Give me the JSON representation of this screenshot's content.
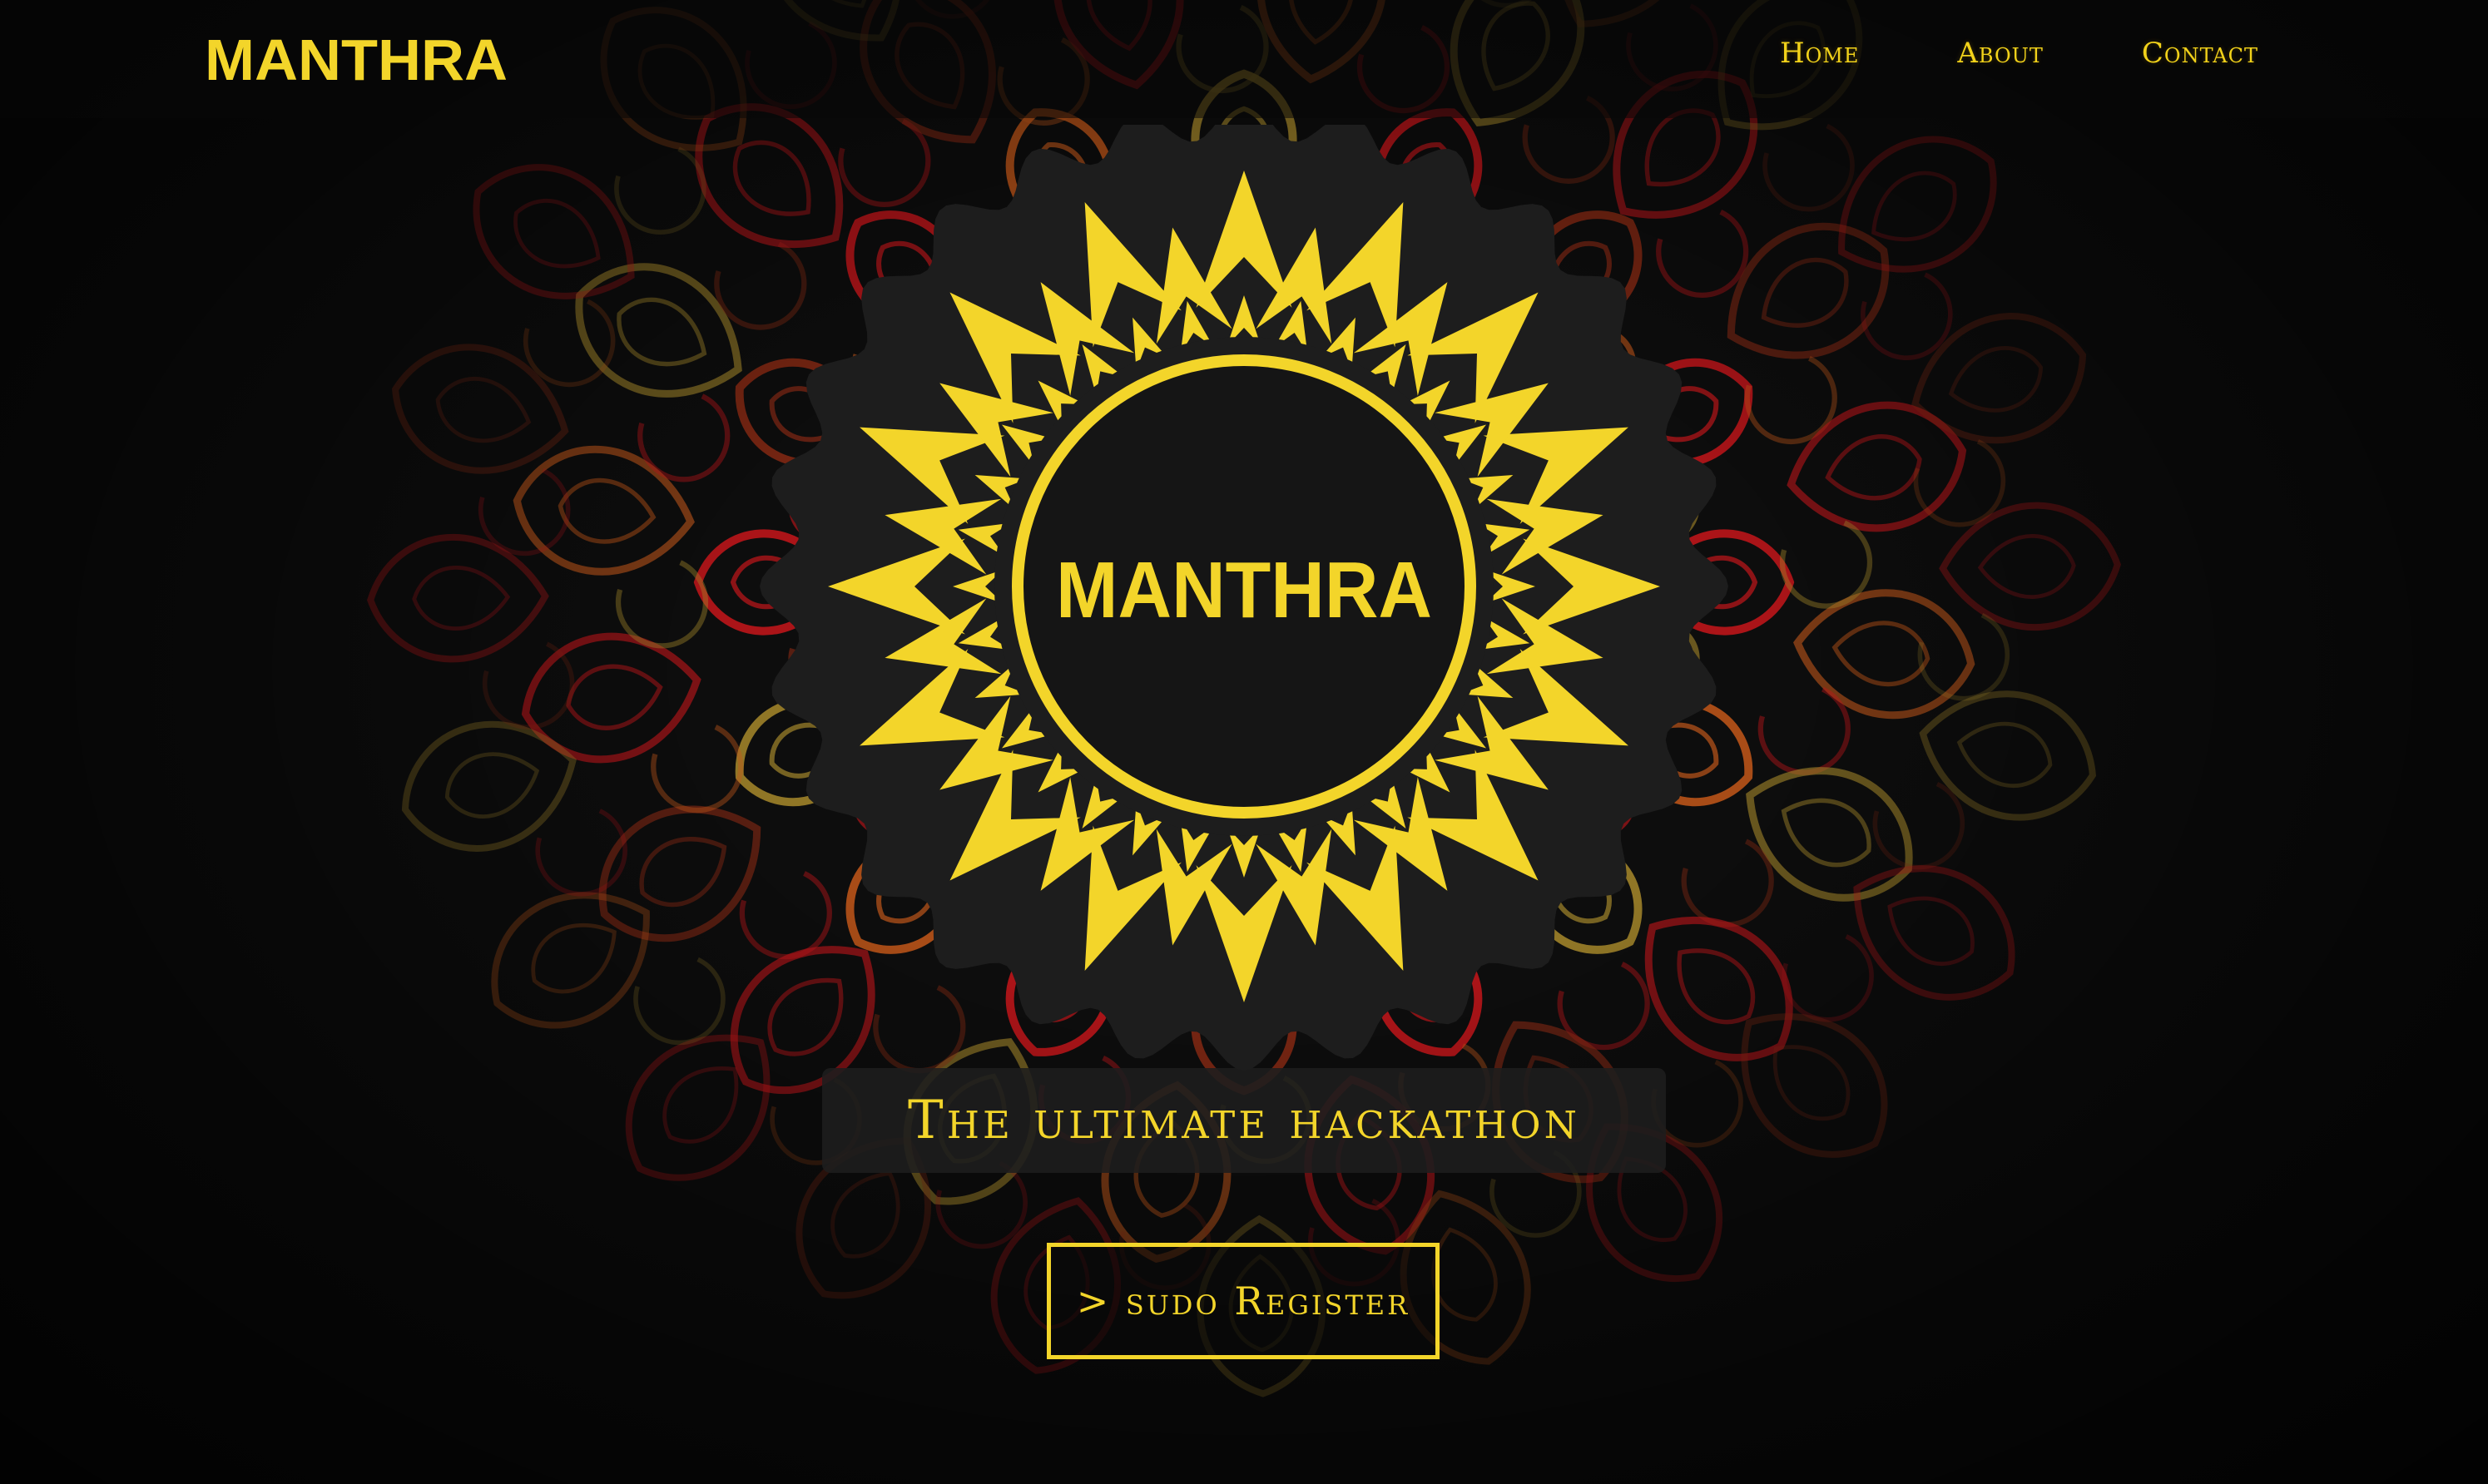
{
  "colors": {
    "accent": "#f3d52a",
    "background": "#0d0d0d",
    "emblem_disc": "#1d1d1d",
    "ornament_red": "#c8161b",
    "ornament_orange": "#c4581a",
    "ornament_gold": "#a88a2c"
  },
  "navbar": {
    "brand": "MANTHRA",
    "links": [
      {
        "label": "Home"
      },
      {
        "label": "About"
      },
      {
        "label": "Contact"
      }
    ]
  },
  "hero": {
    "emblem_text": "MANTHRA",
    "tagline": "The ultimate hackathon",
    "register_button": "> sudo Register"
  },
  "icons": {
    "brand_logo": "manthra-wordmark",
    "emblem": "sun-lotus-mandala-icon",
    "background": "floral-mandala-ornament"
  }
}
